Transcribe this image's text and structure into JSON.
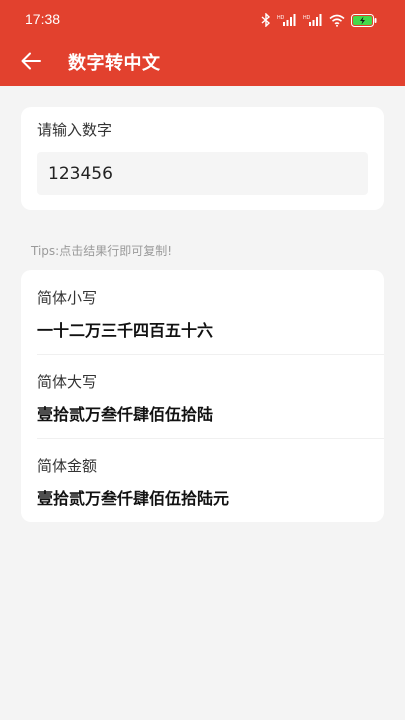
{
  "status_bar": {
    "time": "17:38",
    "icons": [
      "bluetooth-icon",
      "signal-hd-icon",
      "signal-hd-icon",
      "wifi-icon",
      "battery-charging-icon"
    ],
    "battery_color": "#46d94a"
  },
  "app_bar": {
    "title": "数字转中文",
    "back_icon": "arrow-left-icon"
  },
  "input_card": {
    "label": "请输入数字",
    "value": "123456"
  },
  "tips": "Tips:点击结果行即可复制!",
  "results": [
    {
      "label": "简体小写",
      "value": "一十二万三千四百五十六"
    },
    {
      "label": "简体大写",
      "value": "壹拾贰万叁仟肆佰伍拾陆"
    },
    {
      "label": "简体金额",
      "value": "壹拾贰万叁仟肆佰伍拾陆元"
    }
  ],
  "colors": {
    "primary": "#e2412e",
    "background": "#f4f4f4",
    "card": "#ffffff"
  }
}
